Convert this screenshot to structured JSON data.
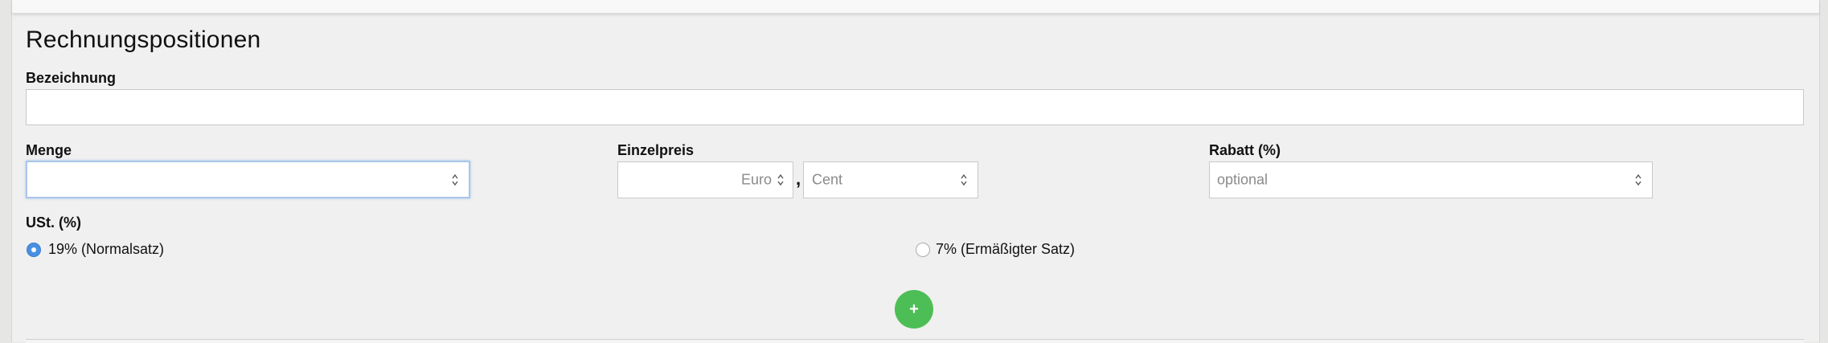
{
  "section": {
    "title": "Rechnungspositionen"
  },
  "fields": {
    "bezeichnung": {
      "label": "Bezeichnung",
      "value": ""
    },
    "menge": {
      "label": "Menge",
      "value": ""
    },
    "einzelpreis": {
      "label": "Einzelpreis",
      "euro_placeholder": "Euro",
      "separator": ",",
      "cent_placeholder": "Cent"
    },
    "rabatt": {
      "label": "Rabatt (%)",
      "placeholder": "optional"
    }
  },
  "ust": {
    "label": "USt. (%)",
    "options": [
      {
        "label": "19% (Normalsatz)",
        "checked": true
      },
      {
        "label": "7% (Ermäßigter Satz)",
        "checked": false
      }
    ]
  },
  "actions": {
    "add_label": "+"
  },
  "colors": {
    "accent_green": "#4cbe55",
    "radio_blue": "#4a90e2",
    "focus_border": "#a9c6ea"
  }
}
